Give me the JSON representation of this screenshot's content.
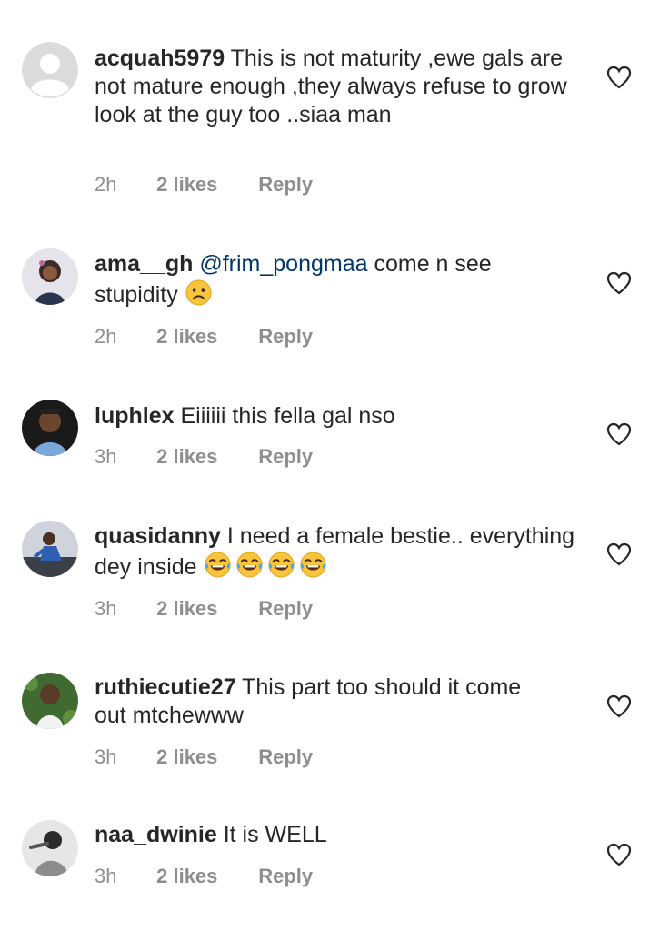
{
  "comments": [
    {
      "username": "acquah5979",
      "text": "This is not maturity ,ewe gals are not mature enough ,they always refuse to grow look at the guy too ..siaa man",
      "time": "2h",
      "likes": "2 likes",
      "reply": "Reply",
      "avatar": "default-avatar-icon"
    },
    {
      "username": "ama__gh",
      "mention": "@frim_pongmaa",
      "text": " come n see stupidity",
      "emoji": "frowning-face",
      "time": "2h",
      "likes": "2 likes",
      "reply": "Reply"
    },
    {
      "username": "luphlex",
      "text": "Eiiiiii this fella gal nso",
      "time": "3h",
      "likes": "2 likes",
      "reply": "Reply"
    },
    {
      "username": "quasidanny",
      "text": "I need a female bestie.. everything dey inside",
      "emoji": "face-with-tears-of-joy",
      "emoji_count": 4,
      "time": "3h",
      "likes": "2 likes",
      "reply": "Reply"
    },
    {
      "username": "ruthiecutie27",
      "text": "This part too should it come out mtchewww",
      "time": "3h",
      "likes": "2 likes",
      "reply": "Reply"
    },
    {
      "username": "naa_dwinie",
      "text": "It is WELL",
      "time": "3h",
      "likes": "2 likes",
      "reply": "Reply"
    }
  ],
  "colors": {
    "text": "#262626",
    "meta": "#8e8e8e",
    "mention": "#00376b",
    "background": "#ffffff"
  }
}
